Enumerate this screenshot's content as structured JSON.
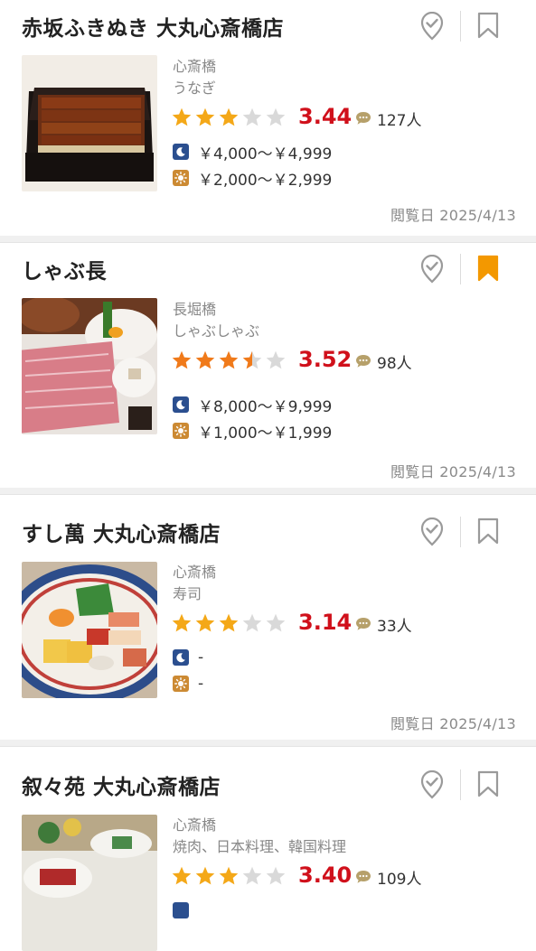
{
  "restaurants": [
    {
      "name": "赤坂ふきぬき 大丸心斎橋店",
      "area": "心斎橋",
      "genre": "うなぎ",
      "rating": "3.44",
      "rating_value": 3.44,
      "reviews": "127人",
      "dinner_price": "￥4,000～￥4,999",
      "lunch_price": "￥2,000～￥2,999",
      "viewed": "閲覧日 2025/4/13",
      "bookmarked": false,
      "photo": "unagi-box-icon"
    },
    {
      "name": "しゃぶ長",
      "area": "長堀橋",
      "genre": "しゃぶしゃぶ",
      "rating": "3.52",
      "rating_value": 3.52,
      "reviews": "98人",
      "dinner_price": "￥8,000～￥9,999",
      "lunch_price": "￥1,000～￥1,999",
      "viewed": "閲覧日 2025/4/13",
      "bookmarked": true,
      "photo": "shabu-beef-icon"
    },
    {
      "name": "すし萬 大丸心斎橋店",
      "area": "心斎橋",
      "genre": "寿司",
      "rating": "3.14",
      "rating_value": 3.14,
      "reviews": "33人",
      "dinner_price": "-",
      "lunch_price": "-",
      "viewed": "閲覧日 2025/4/13",
      "bookmarked": false,
      "photo": "sushi-platter-icon"
    },
    {
      "name": "叙々苑 大丸心斎橋店",
      "area": "心斎橋",
      "genre": "焼肉、日本料理、韓国料理",
      "rating": "3.40",
      "rating_value": 3.4,
      "reviews": "109人",
      "dinner_price": "",
      "lunch_price": "",
      "viewed": "",
      "bookmarked": false,
      "photo": "yakiniku-course-icon"
    }
  ],
  "colors": {
    "score": "#d0101b",
    "star_filled_3": "#f4a818",
    "star_filled_35": "#f07a1a",
    "star_empty": "#d9d9d9",
    "bookmark_active": "#f39800",
    "icon_gray": "#9a9a9a"
  }
}
